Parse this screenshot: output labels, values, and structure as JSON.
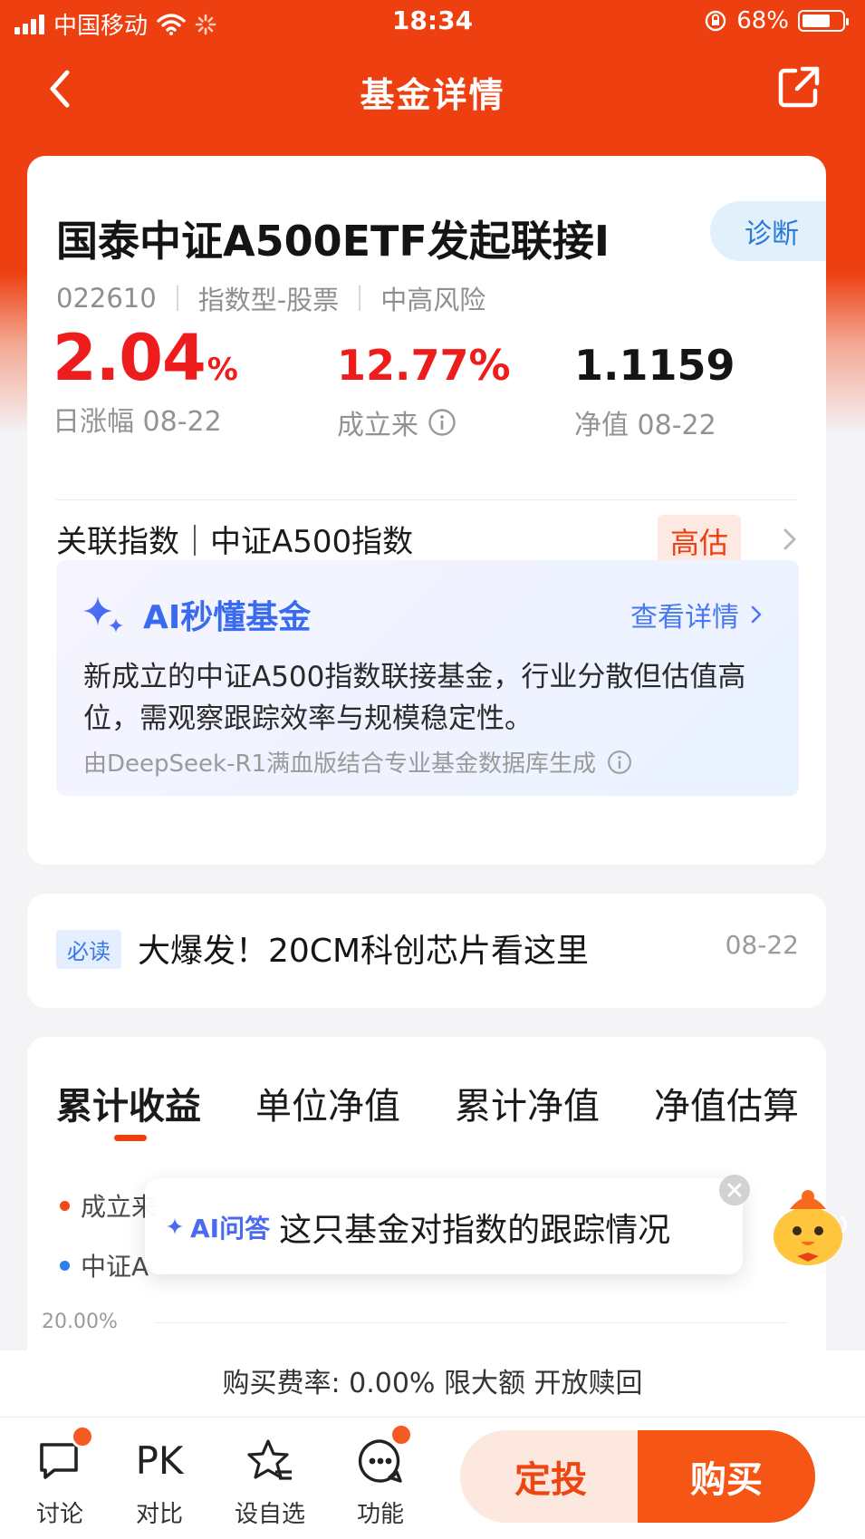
{
  "status_bar": {
    "carrier": "中国移动",
    "time": "18:34",
    "battery": "68%",
    "battery_level": 0.68
  },
  "nav": {
    "title": "基金详情",
    "back_icon": "chevron-left-icon",
    "share_icon": "share-icon"
  },
  "fund": {
    "name": "国泰中证A500ETF发起联接I",
    "diagnose_label": "诊断",
    "code": "022610",
    "type": "指数型-股票",
    "risk": "中高风险",
    "daily_change": "2.04",
    "daily_change_unit": "%",
    "daily_change_label": "日涨幅 08-22",
    "since_inception": "12.77%",
    "since_inception_label": "成立来",
    "nav_value": "1.1159",
    "nav_label": "净值 08-22"
  },
  "index": {
    "label": "关联指数｜中证A500指数",
    "valuation_tag": "高估"
  },
  "ai_summary": {
    "title": "AI秒懂基金",
    "more_label": "查看详情",
    "text": "新成立的中证A500指数联接基金，行业分散但估值高位，需观察跟踪效率与规模稳定性。",
    "source": "由DeepSeek-R1满血版结合专业基金数据库生成"
  },
  "news": {
    "tag": "必读",
    "title": "大爆发！20CM科创芯片看这里",
    "date": "08-22"
  },
  "chart_tabs": {
    "tabs": [
      "累计收益",
      "单位净值",
      "累计净值",
      "净值估算"
    ],
    "active_index": 0
  },
  "chart_legend": {
    "series1_label": "成立来",
    "series2_label": "中证A",
    "y_tick": "20.00%",
    "series1_color": "#f04a1a",
    "series2_color": "#2e7fe8"
  },
  "ai_popup": {
    "tag": "AI问答",
    "text": "这只基金对指数的跟踪情况"
  },
  "fee": {
    "text": "购买费率: 0.00%  限大额  开放赎回"
  },
  "toolbar": {
    "items": [
      {
        "label": "讨论",
        "icon": "chat-bubble-icon"
      },
      {
        "label": "对比",
        "icon": "pk-icon"
      },
      {
        "label": "设自选",
        "icon": "star-list-icon"
      },
      {
        "label": "功能",
        "icon": "more-dots-icon"
      }
    ],
    "pk_text": "PK",
    "fixed_invest_label": "定投",
    "buy_label": "购买"
  },
  "colors": {
    "brand": "#ee3f10",
    "up_red": "#ee1c1c",
    "ai_blue": "#3a6af0"
  }
}
